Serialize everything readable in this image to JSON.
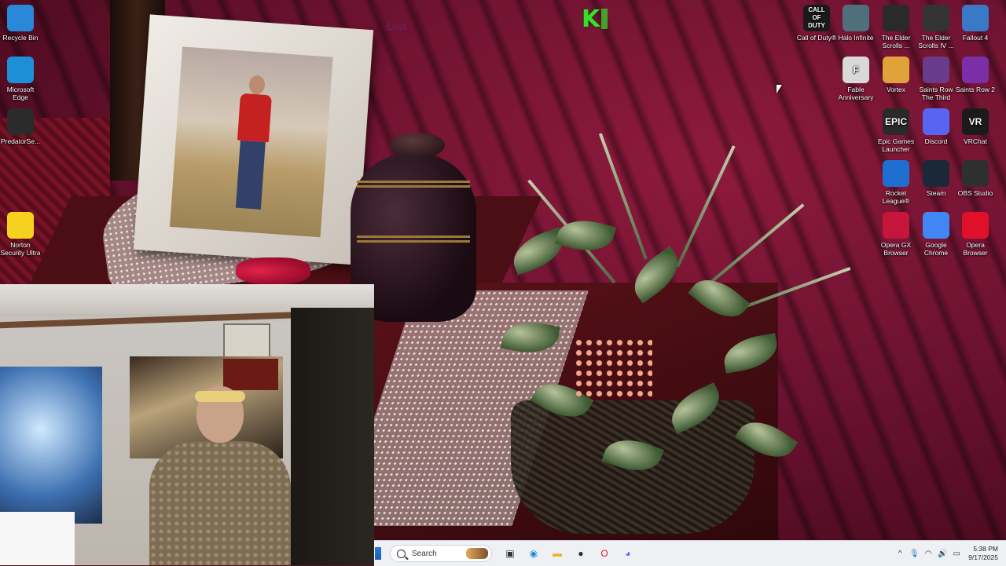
{
  "desktop": {
    "icons_left": [
      {
        "id": "recycle-bin",
        "label": "Recycle Bin",
        "icon": "recycle-bin-icon",
        "color": "#2a88d8"
      },
      {
        "id": "edge",
        "label": "Microsoft Edge",
        "icon": "edge-icon",
        "color": "#1d8fd8"
      },
      {
        "id": "predator",
        "label": "PredatorSe...",
        "icon": "predator-icon",
        "color": "#2b2b2b"
      },
      {
        "id": "norton",
        "label": "Norton Security Ultra",
        "icon": "norton-icon",
        "color": "#f5d21f"
      }
    ],
    "icons_right": [
      {
        "id": "call-of-duty",
        "label": "Call of Duty®",
        "icon": "call-of-duty-icon",
        "text": "CALL OF DUTY",
        "color": "#1a1a1a"
      },
      {
        "id": "halo-infinite",
        "label": "Halo Infinite",
        "icon": "halo-icon",
        "color": "#4f6f7a"
      },
      {
        "id": "elder-scrolls",
        "label": "The Elder Scrolls ...",
        "icon": "skyrim-icon",
        "color": "#2a2a2a"
      },
      {
        "id": "elder-scrolls-iv",
        "label": "The Elder Scrolls IV ...",
        "icon": "oblivion-icon",
        "color": "#333333"
      },
      {
        "id": "fallout-4",
        "label": "Fallout 4",
        "icon": "fallout-icon",
        "color": "#3a78c8"
      },
      {
        "id": "fable",
        "label": "Fable Anniversary",
        "icon": "fable-icon",
        "text": "F",
        "color": "#d9d9d9"
      },
      {
        "id": "vortex",
        "label": "Vortex",
        "icon": "vortex-icon",
        "color": "#e0a33a"
      },
      {
        "id": "saints-row-third",
        "label": "Saints Row The Third",
        "icon": "saints-row-third-icon",
        "color": "#6a3b8a"
      },
      {
        "id": "saints-row-2",
        "label": "Saints Row 2",
        "icon": "saints-row-2-icon",
        "color": "#7a2ea8"
      },
      {
        "id": "epic-games",
        "label": "Epic Games Launcher",
        "icon": "epic-games-icon",
        "text": "EPIC",
        "color": "#2a2a2a"
      },
      {
        "id": "discord",
        "label": "Discord",
        "icon": "discord-icon",
        "color": "#5865f2"
      },
      {
        "id": "vrchat",
        "label": "VRChat",
        "icon": "vrchat-icon",
        "text": "VR",
        "color": "#1b1b1b"
      },
      {
        "id": "rocket-league",
        "label": "Rocket League®",
        "icon": "rocket-league-icon",
        "color": "#1e6fd0"
      },
      {
        "id": "steam",
        "label": "Steam",
        "icon": "steam-icon",
        "color": "#1b2838"
      },
      {
        "id": "obs",
        "label": "OBS Studio",
        "icon": "obs-icon",
        "color": "#2f2f2f"
      },
      {
        "id": "opera-gx",
        "label": "Opera GX Browser",
        "icon": "opera-gx-icon",
        "color": "#c5153a"
      },
      {
        "id": "chrome",
        "label": "Google Chrome",
        "icon": "chrome-icon",
        "color": "#4285f4"
      },
      {
        "id": "opera",
        "label": "Opera Browser",
        "icon": "opera-icon",
        "color": "#e0102a"
      }
    ]
  },
  "overlay": {
    "stream_logo": "K",
    "ghost_text": "Lost"
  },
  "taskbar": {
    "search_placeholder": "Search",
    "pinned": [
      {
        "name": "task-view-icon",
        "glyph": "▣",
        "color": "#333333"
      },
      {
        "name": "edge-taskbar-icon",
        "glyph": "◉",
        "color": "#1d8fd8"
      },
      {
        "name": "file-explorer-icon",
        "glyph": "▬",
        "color": "#e8b62c"
      },
      {
        "name": "game-launcher-icon",
        "glyph": "●",
        "color": "#2a2a2a"
      },
      {
        "name": "opera-taskbar-icon",
        "glyph": "O",
        "color": "#e0102a"
      },
      {
        "name": "discord-taskbar-icon",
        "glyph": "◕",
        "color": "#5865f2"
      }
    ],
    "tray": {
      "chevron": "^",
      "mic": "🎙",
      "wifi": "◠",
      "volume": "🔊",
      "battery": "▭",
      "time": "5:38 PM",
      "date": "9/17/2025"
    }
  }
}
